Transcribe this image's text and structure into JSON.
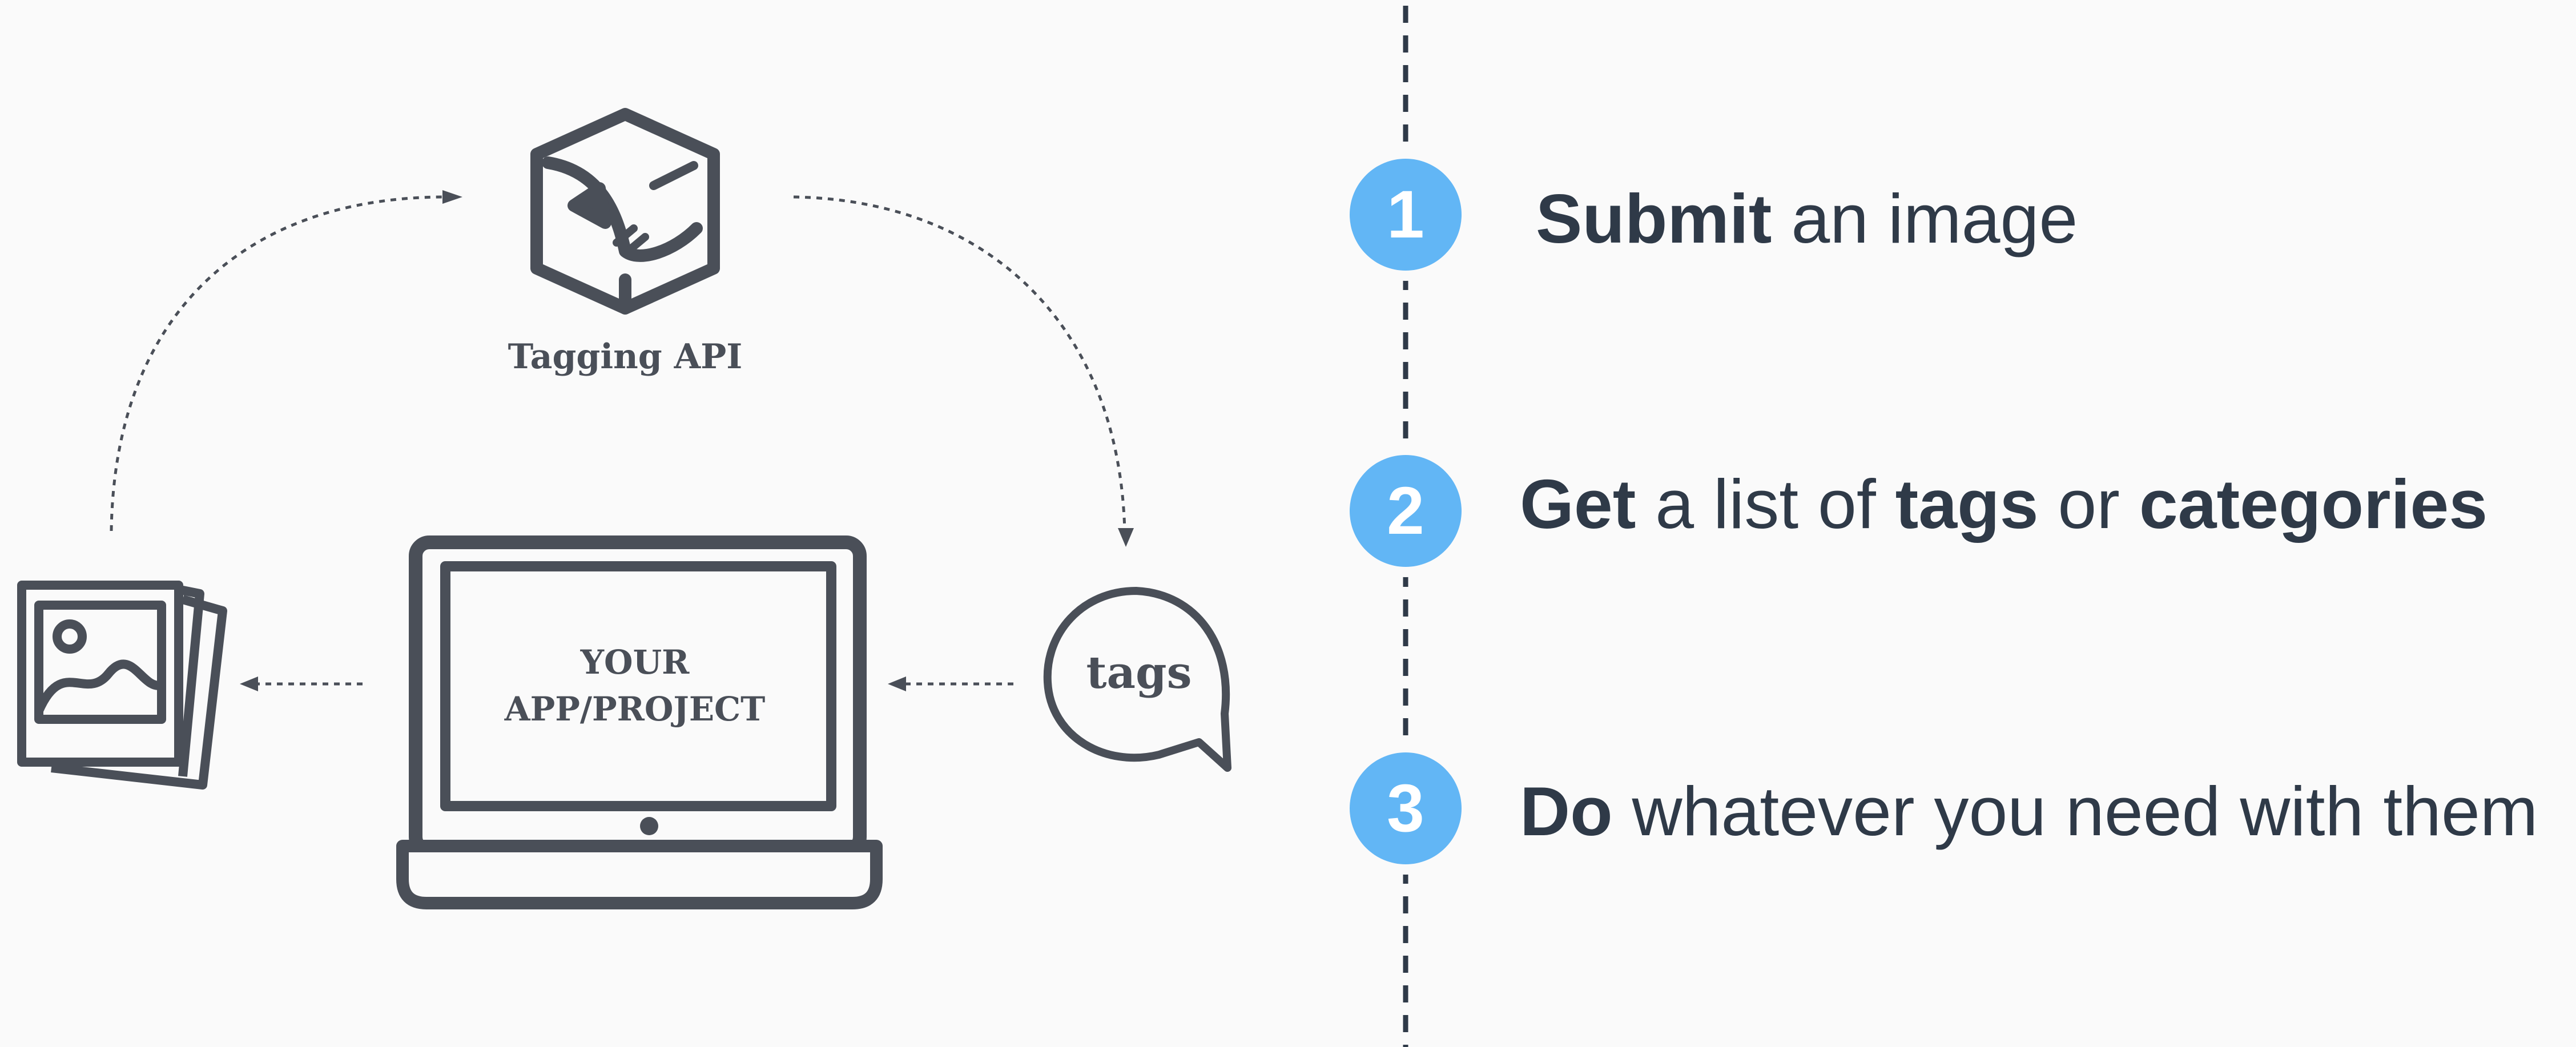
{
  "diagram": {
    "api_label": "Tagging API",
    "app_label_line1": "YOUR",
    "app_label_line2": "APP/PROJECT",
    "tags_label": "tags"
  },
  "steps": [
    {
      "number": "1",
      "bold": "Submit",
      "rest": " an image"
    },
    {
      "number": "2",
      "parts": [
        {
          "text": "Get",
          "bold": true
        },
        {
          "text": " a list of ",
          "bold": false
        },
        {
          "text": "tags",
          "bold": true
        },
        {
          "text": " or ",
          "bold": false
        },
        {
          "text": "categories",
          "bold": true
        }
      ]
    },
    {
      "number": "3",
      "bold": "Do",
      "rest": " whatever you need with them"
    }
  ],
  "colors": {
    "icon_stroke": "#4a4f58",
    "accent": "#62b6f5",
    "text": "#2f3a48",
    "background": "#fafafa"
  }
}
